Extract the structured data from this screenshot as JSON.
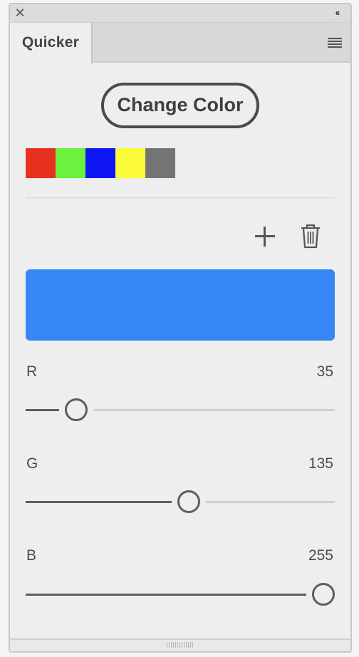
{
  "panel": {
    "tab_label": "Quicker",
    "close_glyph": "✕",
    "collapse_glyph": "‹‹"
  },
  "action": {
    "change_color_label": "Change Color"
  },
  "swatches": [
    {
      "name": "red",
      "color": "#e8301e"
    },
    {
      "name": "green",
      "color": "#6cf23e"
    },
    {
      "name": "blue",
      "color": "#0b16f0"
    },
    {
      "name": "yellow",
      "color": "#fbfb3a"
    },
    {
      "name": "gray",
      "color": "#747474"
    }
  ],
  "preview": {
    "color": "#3587f5"
  },
  "channels": [
    {
      "label": "R",
      "value": "35",
      "fraction": 0.137
    },
    {
      "label": "G",
      "value": "135",
      "fraction": 0.529
    },
    {
      "label": "B",
      "value": "255",
      "fraction": 1.0
    }
  ]
}
